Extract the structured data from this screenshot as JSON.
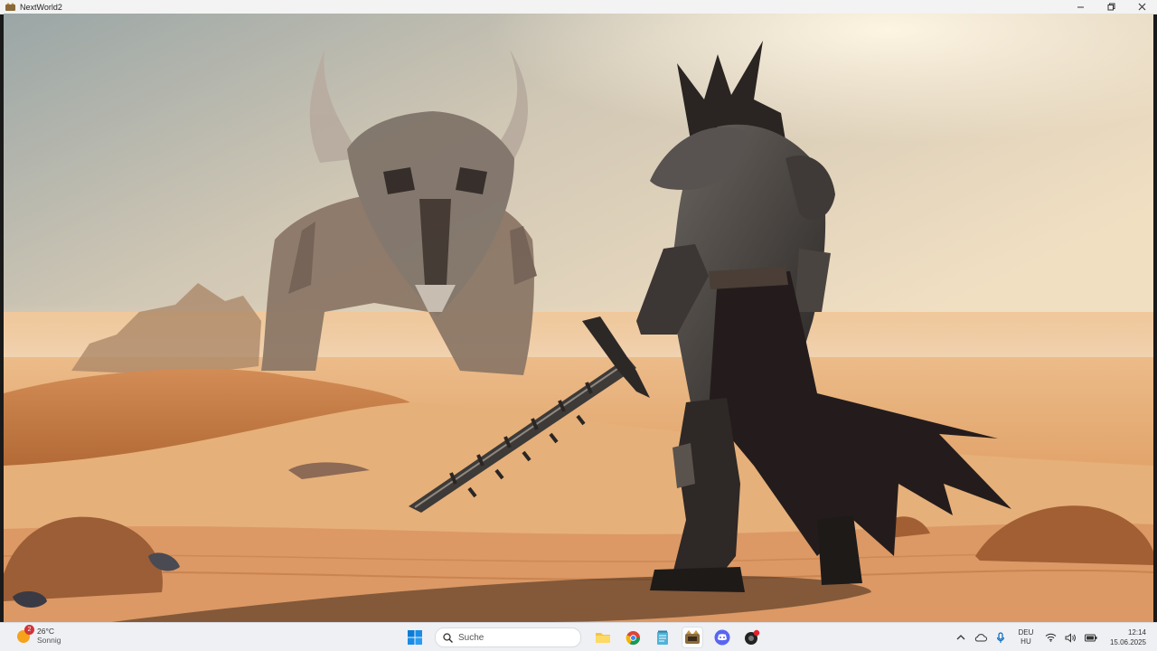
{
  "window": {
    "title": "NextWorld2"
  },
  "taskbar": {
    "weather": {
      "temperature": "26°C",
      "condition": "Sonnig",
      "badge": "2"
    },
    "search": {
      "placeholder": "Suche"
    },
    "pinned": [
      {
        "name": "start",
        "icon": "windows-logo-icon"
      },
      {
        "name": "file-explorer",
        "icon": "folder-icon"
      },
      {
        "name": "chrome",
        "icon": "chrome-icon"
      },
      {
        "name": "notepad",
        "icon": "notepad-icon"
      },
      {
        "name": "nextworld2",
        "icon": "nextworld-app-icon",
        "active": true
      },
      {
        "name": "discord",
        "icon": "discord-icon"
      },
      {
        "name": "recorder",
        "icon": "record-app-icon"
      }
    ],
    "tray": {
      "language_line1": "DEU",
      "language_line2": "HU",
      "time": "12:14",
      "date": "15.06.2025"
    }
  },
  "colors": {
    "accent": "#0067c0",
    "sky_top": "#a9b3b0",
    "sand": "#e3a86e",
    "taskbar": "#eef0f4"
  }
}
